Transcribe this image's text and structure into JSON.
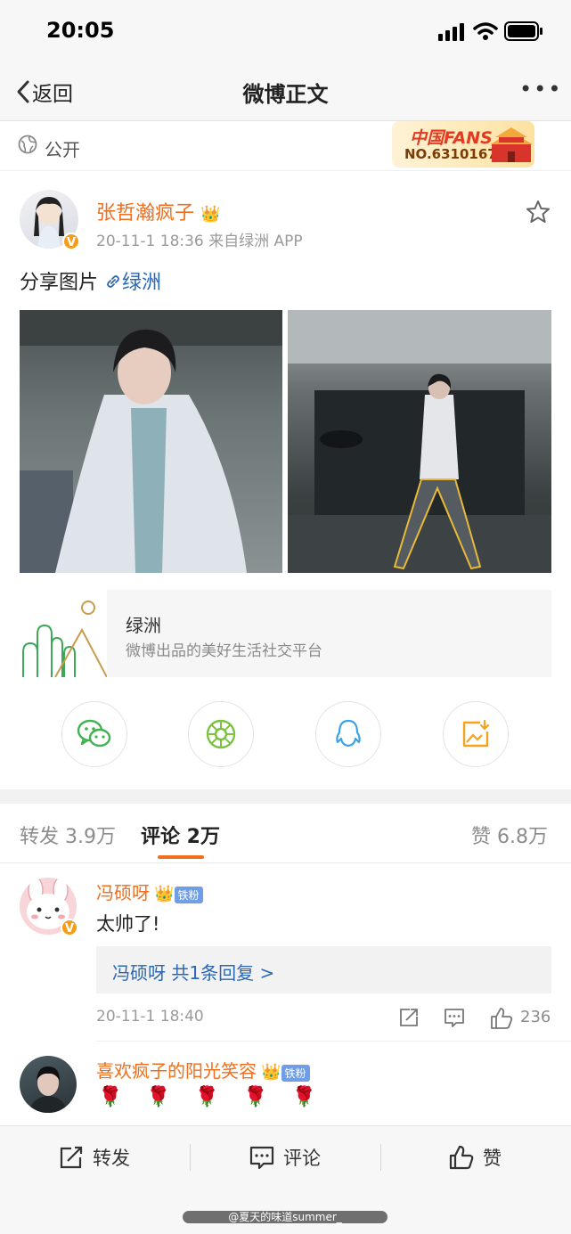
{
  "status_bar": {
    "time": "20:05",
    "icons": [
      "signal-icon",
      "wifi-icon",
      "battery-icon"
    ]
  },
  "nav": {
    "back_label": "返回",
    "title": "微博正文",
    "more": "•••"
  },
  "visibility": {
    "label": "公开",
    "badge_title": "中国FANS",
    "badge_number": "NO.6310167"
  },
  "post": {
    "author": "张哲瀚疯子",
    "meta": "20-11-1 18:36  来自绿洲 APP",
    "text": "分享图片",
    "link_text": "绿洲",
    "verified": "V"
  },
  "link_card": {
    "title": "绿洲",
    "description": "微博出品的美好生活社交平台"
  },
  "share_targets": [
    "wechat-icon",
    "moments-icon",
    "qq-icon",
    "save-image-icon"
  ],
  "tabs": {
    "repost": "转发 3.9万",
    "comment": "评论 2万",
    "like": "赞 6.8万"
  },
  "comments": [
    {
      "name": "冯硕呀",
      "fan_badge": "铁粉",
      "text": "太帅了!",
      "reply": "冯硕呀  共1条回复 >",
      "date": "20-11-1 18:40",
      "likes": "236",
      "verified": "V"
    },
    {
      "name": "喜欢疯子的阳光笑容",
      "fan_badge": "铁粉",
      "text": "🌹 🌹 🌹 🌹 🌹"
    }
  ],
  "bottom_bar": {
    "repost": "转发",
    "comment": "评论",
    "like": "赞"
  },
  "watermark": "@夏天的味道summer_",
  "colors": {
    "accent": "#f06e1d",
    "link": "#2a67b5",
    "like_badge": "#6f9ee6"
  }
}
